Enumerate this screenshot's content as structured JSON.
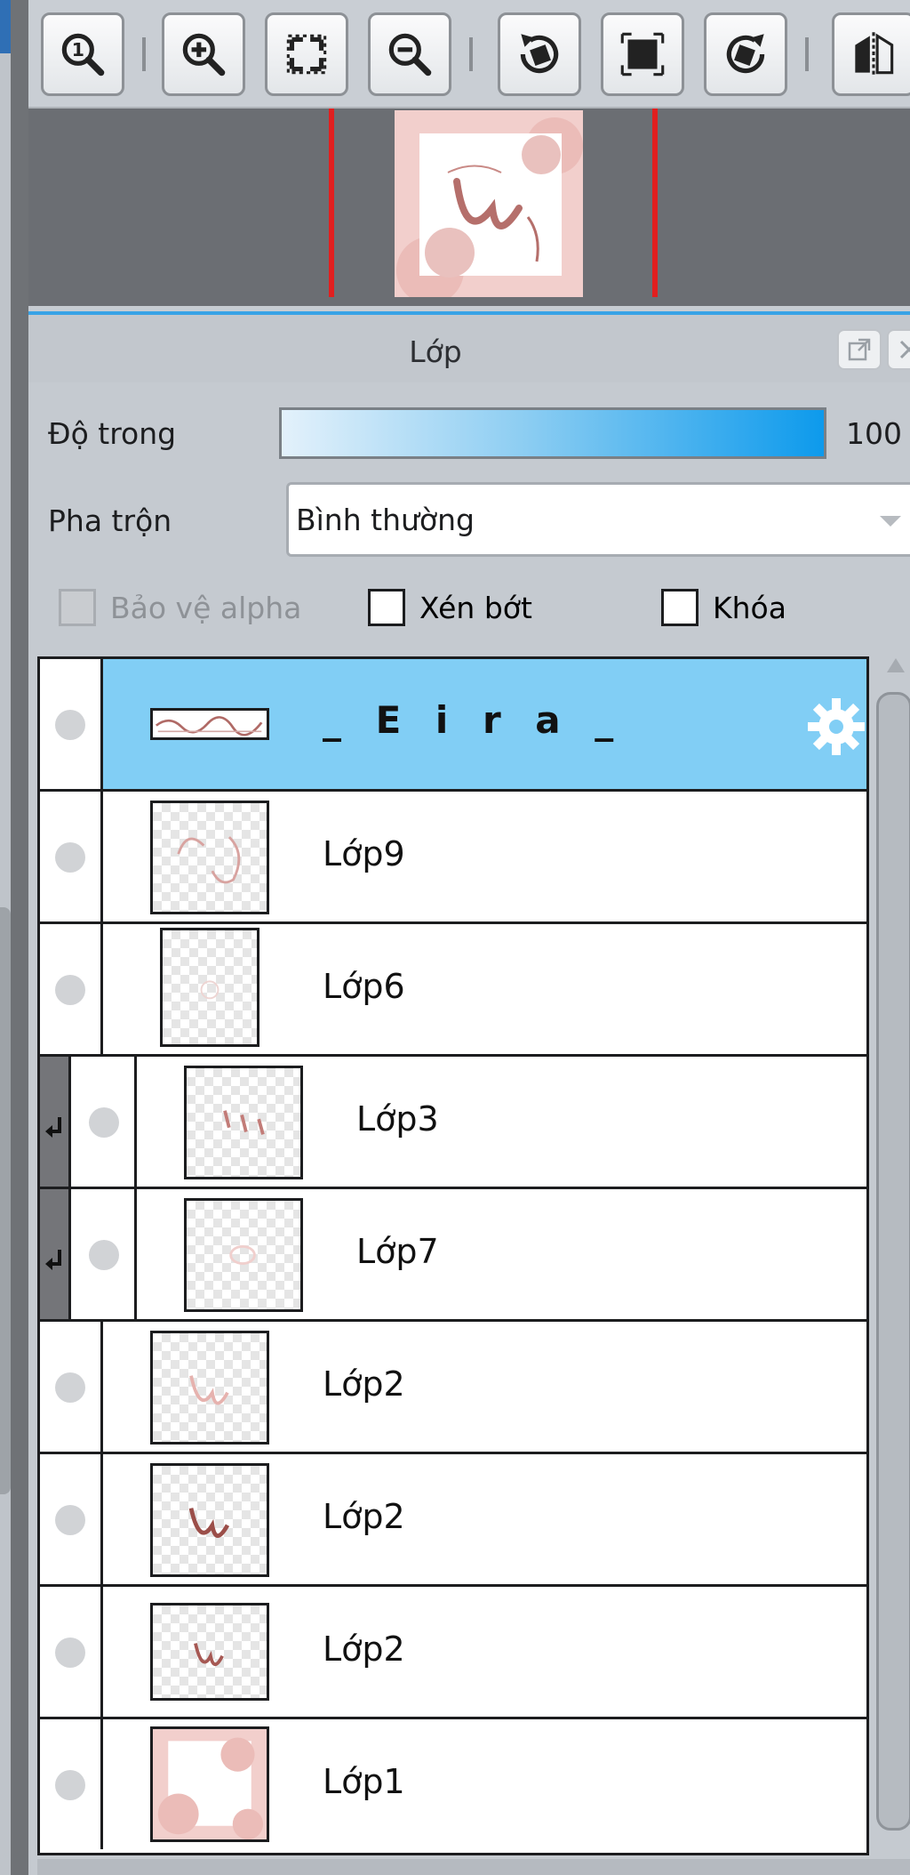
{
  "toolbar": {
    "buttons": [
      {
        "icon": "zoom-actual-size-icon"
      },
      {
        "icon": "zoom-in-icon"
      },
      {
        "icon": "fit-to-window-icon"
      },
      {
        "icon": "zoom-out-icon"
      },
      {
        "icon": "rotate-left-icon"
      },
      {
        "icon": "reset-rotation-icon"
      },
      {
        "icon": "rotate-right-icon"
      },
      {
        "icon": "flip-horizontal-icon"
      }
    ]
  },
  "panel": {
    "title": "Lớp",
    "opacity_label": "Độ trong",
    "opacity_value": "100 %",
    "opacity_fraction": 1.0,
    "blend_label": "Pha trộn",
    "blend_value": "Bình thường",
    "alpha_protect_label": "Bảo vệ alpha",
    "clipping_label": "Xén bớt",
    "lock_label": "Khóa"
  },
  "layers": [
    {
      "name": "_ E i r a _",
      "type": "folder",
      "selected": true,
      "clipped": false
    },
    {
      "name": "Lớp9",
      "type": "layer",
      "selected": false,
      "clipped": false
    },
    {
      "name": "Lớp6",
      "type": "layer",
      "selected": false,
      "clipped": false
    },
    {
      "name": "Lớp3",
      "type": "layer",
      "selected": false,
      "clipped": true
    },
    {
      "name": "Lớp7",
      "type": "layer",
      "selected": false,
      "clipped": true
    },
    {
      "name": "Lớp2",
      "type": "layer",
      "selected": false,
      "clipped": false
    },
    {
      "name": "Lớp2",
      "type": "layer",
      "selected": false,
      "clipped": false
    },
    {
      "name": "Lớp2",
      "type": "layer",
      "selected": false,
      "clipped": false
    },
    {
      "name": "Lớp1",
      "type": "layer",
      "selected": false,
      "clipped": false
    }
  ],
  "colors": {
    "selected_row": "#81cef5",
    "accent": "#38a3e6",
    "navigator_line": "#e11f1f"
  }
}
